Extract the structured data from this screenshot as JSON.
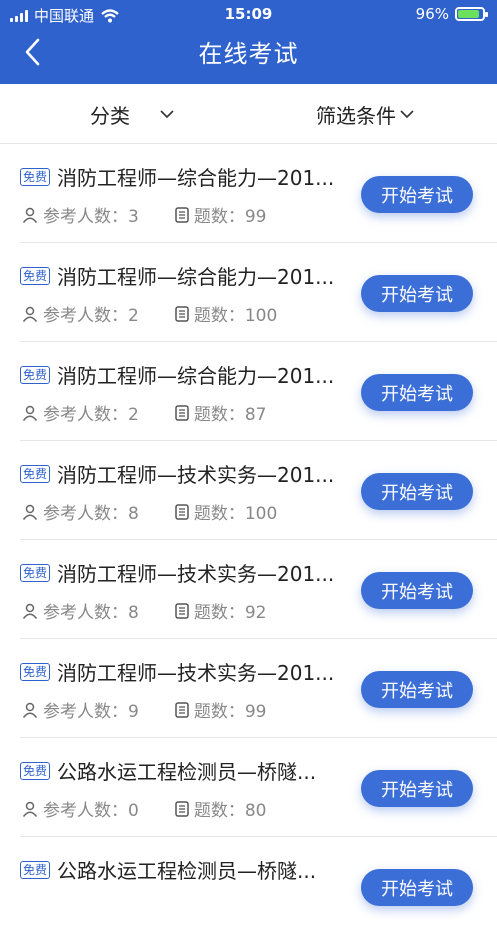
{
  "status_bar": {
    "carrier": "中国联通",
    "time": "15:09",
    "battery": "96%"
  },
  "header": {
    "title": "在线考试"
  },
  "filter": {
    "category_label": "分类",
    "conditions_label": "筛选条件"
  },
  "exams": [
    {
      "badge": "免费",
      "title": "消防工程师—综合能力—201...",
      "participants_label": "参考人数：3",
      "questions_label": "题数：99",
      "button": "开始考试"
    },
    {
      "badge": "免费",
      "title": "消防工程师—综合能力—201...",
      "participants_label": "参考人数：2",
      "questions_label": "题数：100",
      "button": "开始考试"
    },
    {
      "badge": "免费",
      "title": "消防工程师—综合能力—201...",
      "participants_label": "参考人数：2",
      "questions_label": "题数：87",
      "button": "开始考试"
    },
    {
      "badge": "免费",
      "title": "消防工程师—技术实务—201...",
      "participants_label": "参考人数：8",
      "questions_label": "题数：100",
      "button": "开始考试"
    },
    {
      "badge": "免费",
      "title": "消防工程师—技术实务—201...",
      "participants_label": "参考人数：8",
      "questions_label": "题数：92",
      "button": "开始考试"
    },
    {
      "badge": "免费",
      "title": "消防工程师—技术实务—201...",
      "participants_label": "参考人数：9",
      "questions_label": "题数：99",
      "button": "开始考试"
    },
    {
      "badge": "免费",
      "title": "公路水运工程检测员—桥隧...",
      "participants_label": "参考人数：0",
      "questions_label": "题数：80",
      "button": "开始考试"
    },
    {
      "badge": "免费",
      "title": "公路水运工程检测员—桥隧...",
      "participants_label": "",
      "questions_label": "",
      "button": "开始考试"
    }
  ]
}
